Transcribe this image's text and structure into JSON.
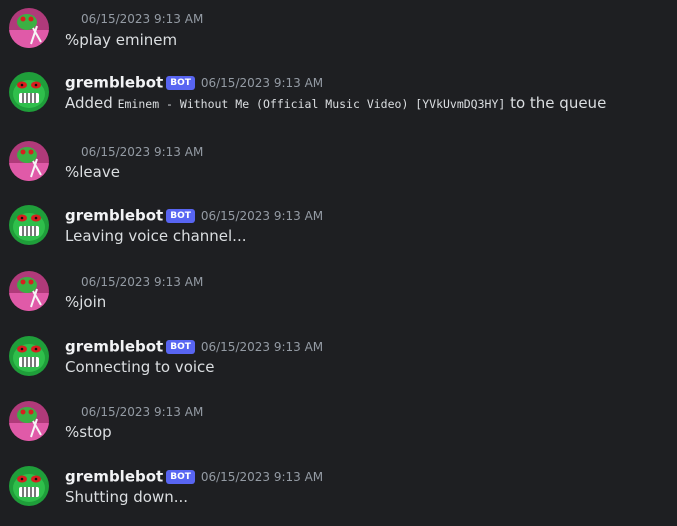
{
  "messages": [
    {
      "author": "",
      "timestamp": "06/15/2023 9:13 AM",
      "text": "%play eminem"
    },
    {
      "author": "gremblebot",
      "badge": "BOT",
      "timestamp": "06/15/2023 9:13 AM",
      "text_before": "Added",
      "code": "Eminem - Without Me (Official Music Video) [YVkUvmDQ3HY]",
      "text_after": "to the queue"
    },
    {
      "author": "",
      "timestamp": "06/15/2023 9:13 AM",
      "text": "%leave"
    },
    {
      "author": "gremblebot",
      "badge": "BOT",
      "timestamp": "06/15/2023 9:13 AM",
      "text": "Leaving voice channel..."
    },
    {
      "author": "",
      "timestamp": "06/15/2023 9:13 AM",
      "text": "%join"
    },
    {
      "author": "gremblebot",
      "badge": "BOT",
      "timestamp": "06/15/2023 9:13 AM",
      "text": "Connecting to voice"
    },
    {
      "author": "",
      "timestamp": "06/15/2023 9:13 AM",
      "text": "%stop"
    },
    {
      "author": "gremblebot",
      "badge": "BOT",
      "timestamp": "06/15/2023 9:13 AM",
      "text": "Shutting down..."
    }
  ],
  "icons": {
    "user_avatar": "pink-frog-avatar-icon",
    "bot_avatar": "green-gremlin-avatar-icon"
  },
  "colors": {
    "background": "#1e1f22",
    "bot_badge": "#5865f2",
    "bot_avatar_bg": "#1f9e3a",
    "user_avatar_bg": "#b03a7a"
  }
}
